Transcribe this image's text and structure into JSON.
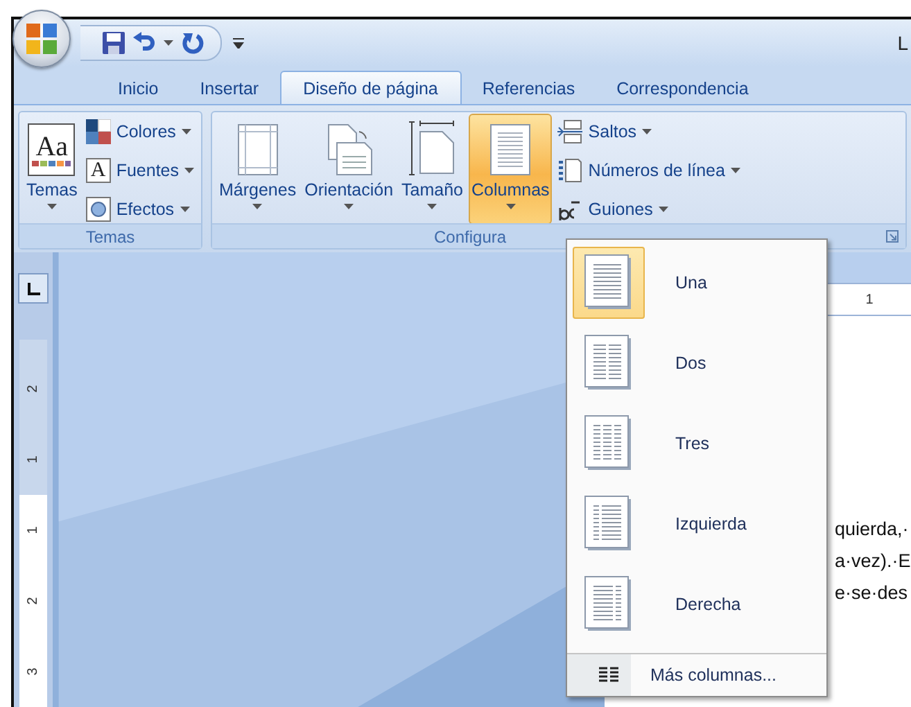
{
  "window": {
    "title": "L"
  },
  "tabs": [
    {
      "label": "Inicio",
      "selected": false
    },
    {
      "label": "Insertar",
      "selected": false
    },
    {
      "label": "Diseño de página",
      "selected": true
    },
    {
      "label": "Referencias",
      "selected": false
    },
    {
      "label": "Correspondencia",
      "selected": false
    }
  ],
  "ribbon": {
    "groups": [
      {
        "label": "Temas",
        "large": [
          {
            "label": "Temas",
            "kind": "themes",
            "glyph": "Aa",
            "active": false
          }
        ],
        "small": [
          {
            "label": "Colores",
            "kind": "colors"
          },
          {
            "label": "Fuentes",
            "kind": "fonts",
            "glyph": "A"
          },
          {
            "label": "Efectos",
            "kind": "effects"
          }
        ],
        "launcher": false
      },
      {
        "label": "Configura",
        "large": [
          {
            "label": "Márgenes",
            "kind": "margins",
            "active": false
          },
          {
            "label": "Orientación",
            "kind": "orientation",
            "active": false
          },
          {
            "label": "Tamaño",
            "kind": "size",
            "active": false
          },
          {
            "label": "Columnas",
            "kind": "columns",
            "active": true
          }
        ],
        "small": [
          {
            "label": "Saltos",
            "kind": "breaks"
          },
          {
            "label": "Números de línea",
            "kind": "linenumbers"
          },
          {
            "label": "Guiones",
            "kind": "hyphen"
          }
        ],
        "launcher": true
      }
    ]
  },
  "vertical_ruler": {
    "marks": [
      "2",
      "1",
      "1",
      "2",
      "3"
    ]
  },
  "horizontal_ruler": {
    "marks": [
      "1"
    ]
  },
  "document": {
    "lines": [
      "quierda,·",
      "a·vez).·E",
      "e·se·des"
    ]
  },
  "columns_menu": {
    "items": [
      {
        "label": "Una",
        "kind": "one",
        "selected": true
      },
      {
        "label": "Dos",
        "kind": "two",
        "selected": false
      },
      {
        "label": "Tres",
        "kind": "three",
        "selected": false
      },
      {
        "label": "Izquierda",
        "kind": "left",
        "selected": false
      },
      {
        "label": "Derecha",
        "kind": "right",
        "selected": false
      }
    ],
    "more": {
      "label": "Más columnas..."
    }
  }
}
